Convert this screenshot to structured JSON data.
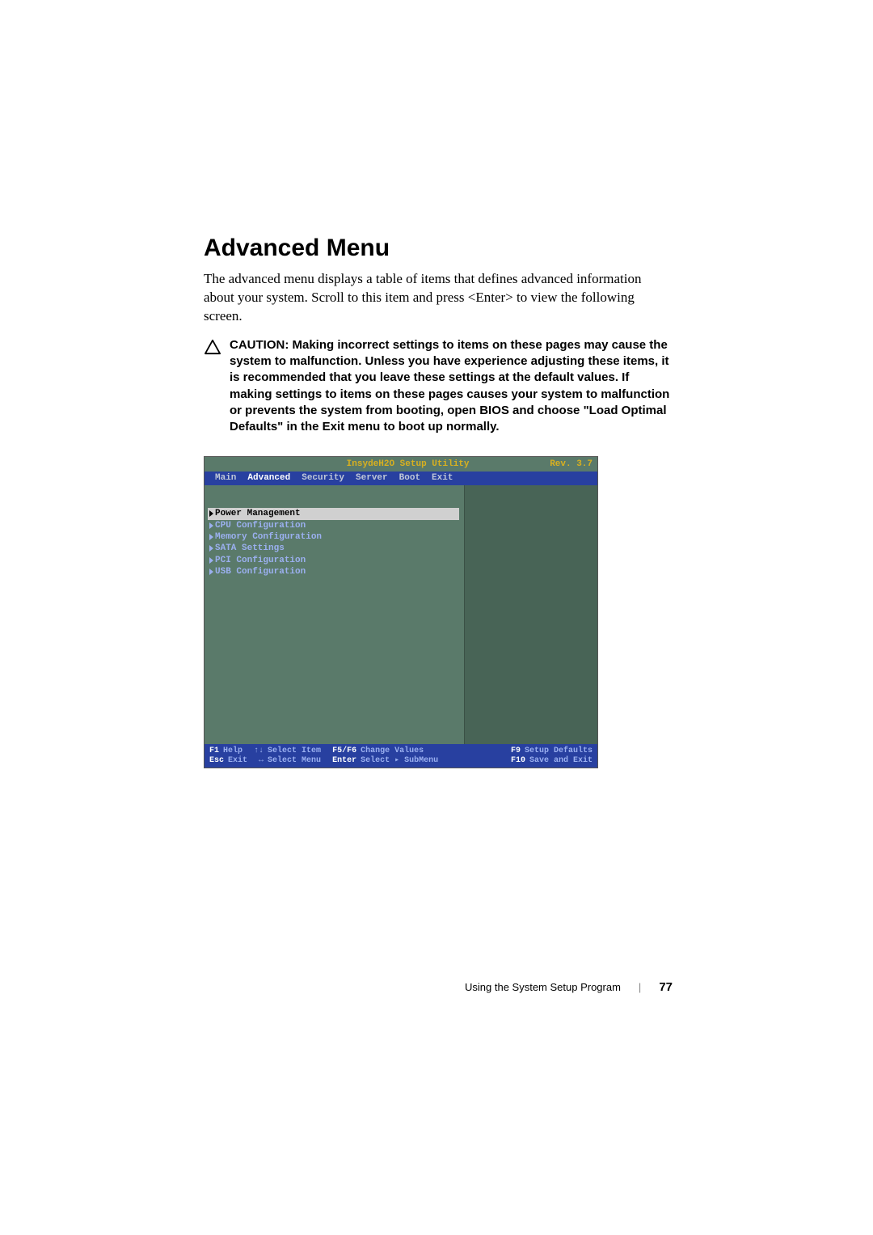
{
  "heading": "Advanced Menu",
  "intro": "The advanced menu displays a table of items that defines advanced information about your system. Scroll to this item and press <Enter> to view the following screen.",
  "caution_label": "CAUTION: ",
  "caution_body": "Making incorrect settings to items on these pages may cause the system to malfunction. Unless you have experience adjusting these items, it is recommended that you leave these settings at the default values. If making settings to items on these pages causes your system to malfunction or prevents the system from booting, open BIOS and choose \"Load Optimal Defaults\" in the Exit menu to boot up normally.",
  "bios": {
    "title": "InsydeH2O Setup Utility",
    "rev": "Rev. 3.7",
    "tabs": {
      "main": "Main",
      "advanced": "Advanced",
      "security": "Security",
      "server": "Server",
      "boot": "Boot",
      "exit": "Exit"
    },
    "menu": {
      "power": "Power Management",
      "cpu": "CPU Configuration",
      "memory": "Memory Configuration",
      "sata": "SATA Settings",
      "pci": "PCI Configuration",
      "usb": "USB Configuration"
    },
    "footer": {
      "f1": "F1",
      "help": "Help",
      "select_item": "Select Item",
      "f5f6": "F5/F6",
      "change_values": "Change Values",
      "f9": "F9",
      "setup_defaults": "Setup Defaults",
      "esc": "Esc",
      "exit": "Exit",
      "select_menu": "Select Menu",
      "enter": "Enter",
      "select_submenu": "Select ▸ SubMenu",
      "f10": "F10",
      "save_exit": "Save and Exit"
    }
  },
  "footer": {
    "text": "Using the System Setup Program",
    "page": "77"
  }
}
